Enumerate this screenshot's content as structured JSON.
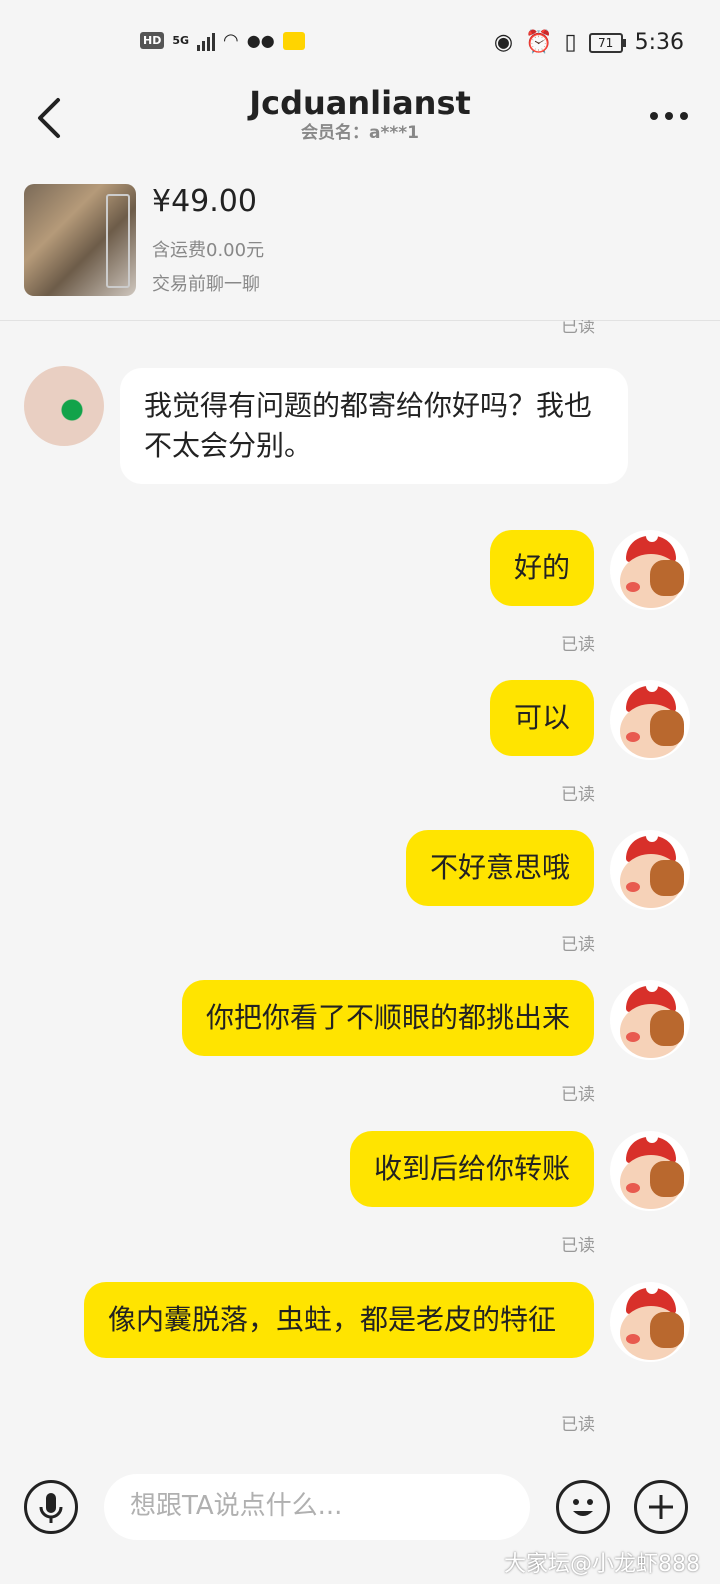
{
  "status_bar": {
    "hd": "HD",
    "network": "5G",
    "battery": "71",
    "time": "5:36"
  },
  "header": {
    "title": "Jcduanlianst",
    "member": "会员名：a***1"
  },
  "product": {
    "price": "¥49.00",
    "shipping": "含运费0.00元",
    "hint": "交易前聊一聊"
  },
  "read_label": "已读",
  "messages": [
    {
      "side": "left",
      "text": "我觉得有问题的都寄给你好吗？我也不太会分别。"
    },
    {
      "side": "right",
      "text": "好的",
      "status": "已读"
    },
    {
      "side": "right",
      "text": "可以",
      "status": "已读"
    },
    {
      "side": "right",
      "text": "不好意思哦",
      "status": "已读"
    },
    {
      "side": "right",
      "text": "你把你看了不顺眼的都挑出来",
      "status": "已读"
    },
    {
      "side": "right",
      "text": "收到后给你转账",
      "status": "已读"
    },
    {
      "side": "right",
      "text": "像内囊脱落，虫蛀，都是老皮的特征",
      "status": "已读"
    }
  ],
  "input": {
    "placeholder": "想跟TA说点什么..."
  },
  "watermark": "大家坛@小龙虾888"
}
